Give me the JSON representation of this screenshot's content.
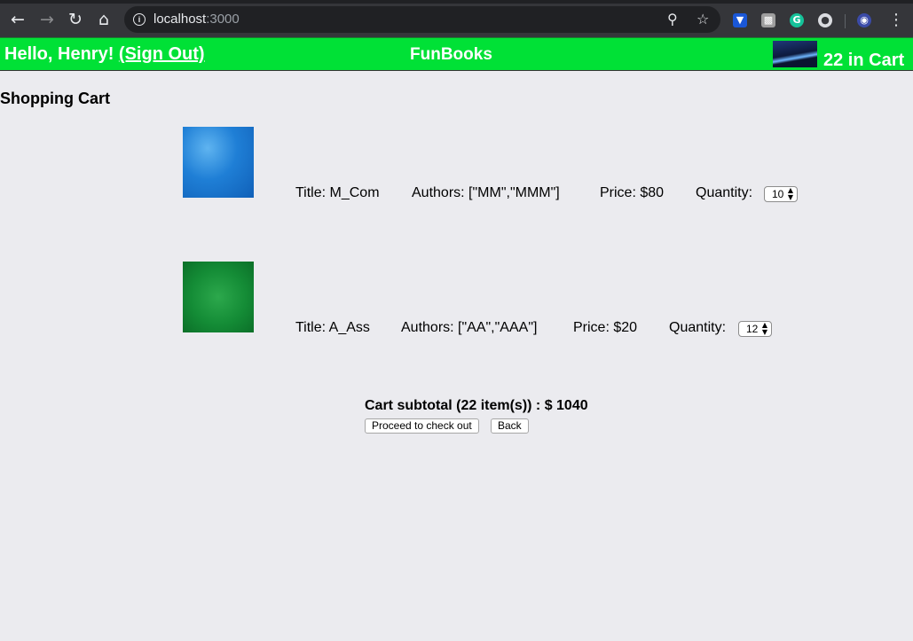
{
  "browser": {
    "back_icon": "arrow-left-icon",
    "forward_icon": "arrow-right-icon",
    "reload_icon": "reload-icon",
    "home_icon": "home-icon",
    "url_host": "localhost",
    "url_port": ":3000",
    "menu_icon": "more-vertical-icon"
  },
  "header": {
    "greeting": "Hello, Henry!",
    "sign_out": "(Sign Out)",
    "brand": "FunBooks",
    "cart_count": "22 in Cart",
    "background_color": "#00e136"
  },
  "page": {
    "title": "Shopping Cart"
  },
  "cart": {
    "items": [
      {
        "title": "Title: M_Com",
        "authors": "Authors: [\"MM\",\"MMM\"]",
        "price": "Price: $80",
        "quantity_label": "Quantity:",
        "quantity": "10"
      },
      {
        "title": "Title: A_Ass",
        "authors": "Authors: [\"AA\",\"AAA\"]",
        "price": "Price: $20",
        "quantity_label": "Quantity:",
        "quantity": "12"
      }
    ],
    "subtotal": "Cart subtotal (22 item(s)) : $ 1040",
    "checkout_label": "Proceed to check out",
    "back_label": "Back"
  }
}
